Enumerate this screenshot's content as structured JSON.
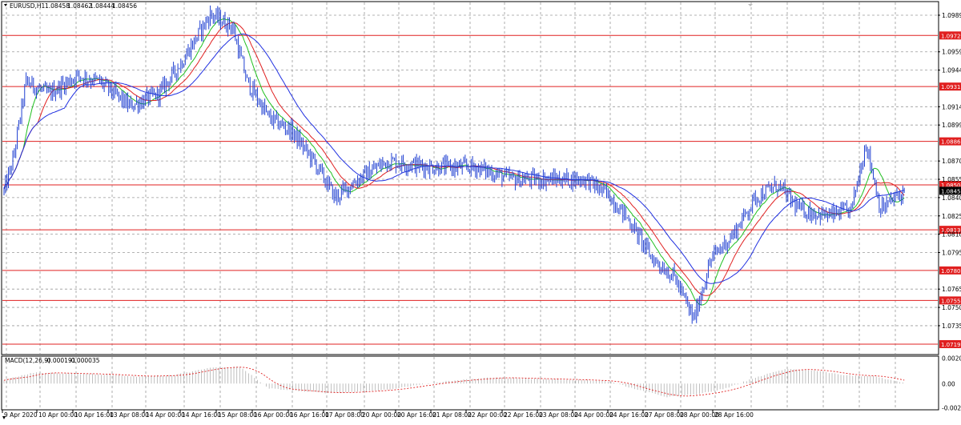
{
  "symbol_header": {
    "symbol": "EURUSD,H1",
    "open": "1.08458",
    "high": "1.08462",
    "low": "1.08444",
    "close": "1.08456"
  },
  "indicator_header": {
    "name": "MACD(12,26,9)",
    "macd": "-0.000191",
    "signal": "-0.000035"
  },
  "price_axis": {
    "labels": [
      "1.09895",
      "1.09595",
      "1.09445",
      "1.09145",
      "1.08995",
      "1.08700",
      "1.08550",
      "1.08400",
      "1.08250",
      "1.08100",
      "1.07950",
      "1.07650",
      "1.07500",
      "1.07350"
    ],
    "ymin": 1.0712,
    "ymax": 1.1
  },
  "horizontal_levels": [
    {
      "price": 1.09729,
      "label": "1.09729"
    },
    {
      "price": 1.0931,
      "label": "1.09310"
    },
    {
      "price": 1.08861,
      "label": "1.08861"
    },
    {
      "price": 1.08504,
      "label": "1.08504"
    },
    {
      "price": 1.08136,
      "label": "1.08136"
    },
    {
      "price": 1.07803,
      "label": "1.07803"
    },
    {
      "price": 1.07557,
      "label": "1.07557"
    },
    {
      "price": 1.07199,
      "label": "1.07199"
    }
  ],
  "current_price": {
    "price": 1.08456,
    "label": "1.08456"
  },
  "macd_axis": {
    "labels": [
      "0.002086",
      "0.00",
      "-0.002008"
    ],
    "ymin": -0.0021,
    "ymax": 0.0022
  },
  "time_axis": {
    "labels": [
      "9 Apr 2020",
      "10 Apr 00:00",
      "10 Apr 16:00",
      "13 Apr 08:00",
      "14 Apr 00:00",
      "14 Apr 16:00",
      "15 Apr 08:00",
      "16 Apr 00:00",
      "16 Apr 16:00",
      "17 Apr 08:00",
      "20 Apr 00:00",
      "20 Apr 16:00",
      "21 Apr 08:00",
      "22 Apr 00:00",
      "22 Apr 16:00",
      "23 Apr 08:00",
      "24 Apr 00:00",
      "24 Apr 16:00",
      "27 Apr 08:00",
      "28 Apr 00:00",
      "28 Apr 16:00"
    ]
  },
  "colors": {
    "bars": "#1f3fd1",
    "level_lines": "#e02020",
    "label_bg": "#e02020",
    "ma_fast": "#20c020",
    "ma_mid": "#e02020",
    "ma_slow": "#2030e0",
    "grid": "#9a9a9a",
    "macd_hist": "#b0b0b0",
    "macd_signal": "#e02020",
    "current_bg": "#000000"
  },
  "chart_data": {
    "type": "line",
    "title": "EURUSD,H1",
    "series": [
      {
        "name": "EURUSD,H1",
        "role": "price",
        "keypoints": [
          [
            0,
            1.0845
          ],
          [
            6,
            1.087
          ],
          [
            15,
            1.0935
          ],
          [
            30,
            1.0925
          ],
          [
            50,
            1.094
          ],
          [
            65,
            1.0935
          ],
          [
            85,
            1.0915
          ],
          [
            105,
            1.0925
          ],
          [
            120,
            1.095
          ],
          [
            140,
            1.099
          ],
          [
            155,
            1.098
          ],
          [
            165,
            1.0935
          ],
          [
            180,
            1.0905
          ],
          [
            195,
            1.0895
          ],
          [
            210,
            1.087
          ],
          [
            225,
            1.084
          ],
          [
            240,
            1.0855
          ],
          [
            260,
            1.087
          ],
          [
            290,
            1.0865
          ],
          [
            320,
            1.0865
          ],
          [
            345,
            1.0855
          ],
          [
            370,
            1.0855
          ],
          [
            395,
            1.0855
          ],
          [
            412,
            1.084
          ],
          [
            425,
            1.082
          ],
          [
            440,
            1.079
          ],
          [
            455,
            1.0775
          ],
          [
            468,
            1.074
          ],
          [
            480,
            1.079
          ],
          [
            495,
            1.081
          ],
          [
            510,
            1.084
          ],
          [
            525,
            1.085
          ],
          [
            540,
            1.083
          ],
          [
            560,
            1.0825
          ],
          [
            575,
            1.083
          ],
          [
            585,
            1.0885
          ],
          [
            595,
            1.083
          ],
          [
            605,
            1.084
          ],
          [
            612,
            1.0845
          ]
        ]
      },
      {
        "name": "MACD(12,26,9)",
        "role": "macd",
        "keypoints": [
          [
            0,
            0.0003
          ],
          [
            20,
            0.0009
          ],
          [
            60,
            0.0008
          ],
          [
            90,
            0.0006
          ],
          [
            115,
            0.0007
          ],
          [
            140,
            0.0013
          ],
          [
            160,
            0.0014
          ],
          [
            180,
            -0.0004
          ],
          [
            220,
            -0.0008
          ],
          [
            260,
            -0.0005
          ],
          [
            300,
            0.0002
          ],
          [
            330,
            0.0005
          ],
          [
            360,
            0.0004
          ],
          [
            390,
            0.0003
          ],
          [
            410,
            0.0002
          ],
          [
            430,
            -0.0005
          ],
          [
            450,
            -0.0011
          ],
          [
            470,
            -0.0009
          ],
          [
            490,
            -0.0004
          ],
          [
            510,
            0.0005
          ],
          [
            530,
            0.0012
          ],
          [
            550,
            0.0011
          ],
          [
            570,
            0.0007
          ],
          [
            590,
            0.0006
          ],
          [
            612,
            0.0
          ]
        ]
      }
    ]
  }
}
